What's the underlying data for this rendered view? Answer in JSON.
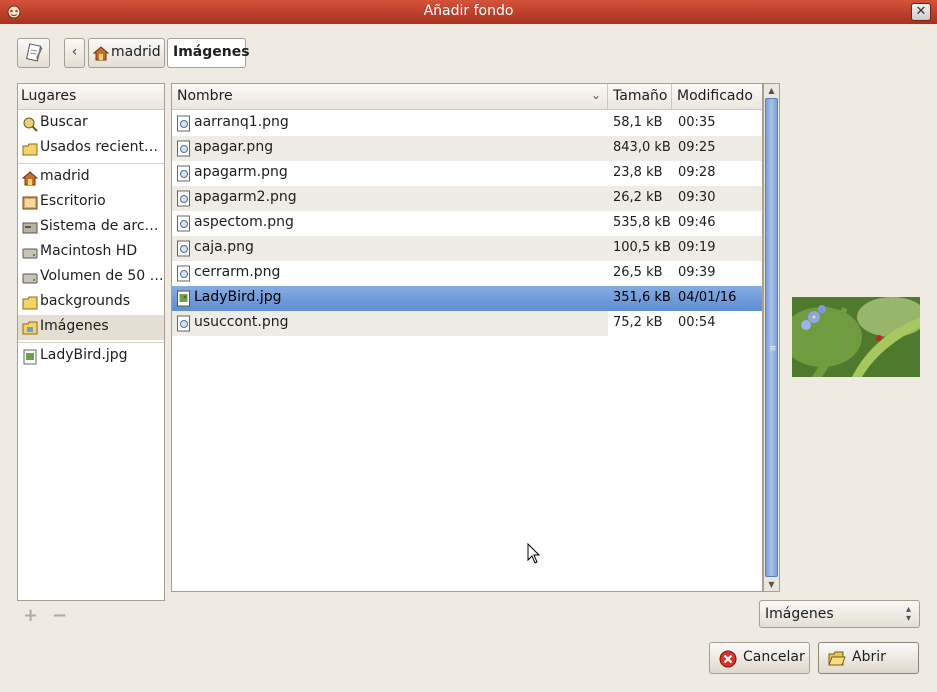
{
  "window": {
    "title": "Añadir fondo"
  },
  "breadcrumb": {
    "home": "madrid",
    "current": "Imágenes"
  },
  "places": {
    "header": "Lugares",
    "items": [
      {
        "label": "Buscar",
        "icon": "search-icon"
      },
      {
        "label": "Usados recient…",
        "icon": "recent-icon"
      },
      {
        "label": "madrid",
        "icon": "home-icon"
      },
      {
        "label": "Escritorio",
        "icon": "desktop-icon"
      },
      {
        "label": "Sistema de arc…",
        "icon": "filesystem-icon"
      },
      {
        "label": "Macintosh HD",
        "icon": "drive-icon"
      },
      {
        "label": "Volumen de 50 …",
        "icon": "drive-icon"
      },
      {
        "label": "backgrounds",
        "icon": "folder-icon"
      },
      {
        "label": "Imágenes",
        "icon": "pictures-folder-icon"
      },
      {
        "label": "LadyBird.jpg",
        "icon": "image-file-icon"
      }
    ]
  },
  "columns": {
    "name": "Nombre",
    "size": "Tamaño",
    "modified": "Modificado"
  },
  "files": [
    {
      "name": "aarranq1.png",
      "size": "58,1 kB",
      "modified": "00:35"
    },
    {
      "name": "apagar.png",
      "size": "843,0 kB",
      "modified": "09:25"
    },
    {
      "name": "apagarm.png",
      "size": "23,8 kB",
      "modified": "09:28"
    },
    {
      "name": "apagarm2.png",
      "size": "26,2 kB",
      "modified": "09:30"
    },
    {
      "name": "aspectom.png",
      "size": "535,8 kB",
      "modified": "09:46"
    },
    {
      "name": "caja.png",
      "size": "100,5 kB",
      "modified": "09:19"
    },
    {
      "name": "cerrarm.png",
      "size": "26,5 kB",
      "modified": "09:39"
    },
    {
      "name": "LadyBird.jpg",
      "size": "351,6 kB",
      "modified": "04/01/16"
    },
    {
      "name": "usuccont.png",
      "size": "75,2 kB",
      "modified": "00:54"
    }
  ],
  "filter": {
    "selected": "Imágenes"
  },
  "buttons": {
    "cancel": "Cancelar",
    "open": "Abrir"
  },
  "colors": {
    "titlebar": "#c0432b",
    "selection": "#6e98d8",
    "background": "#f0ebe2"
  }
}
